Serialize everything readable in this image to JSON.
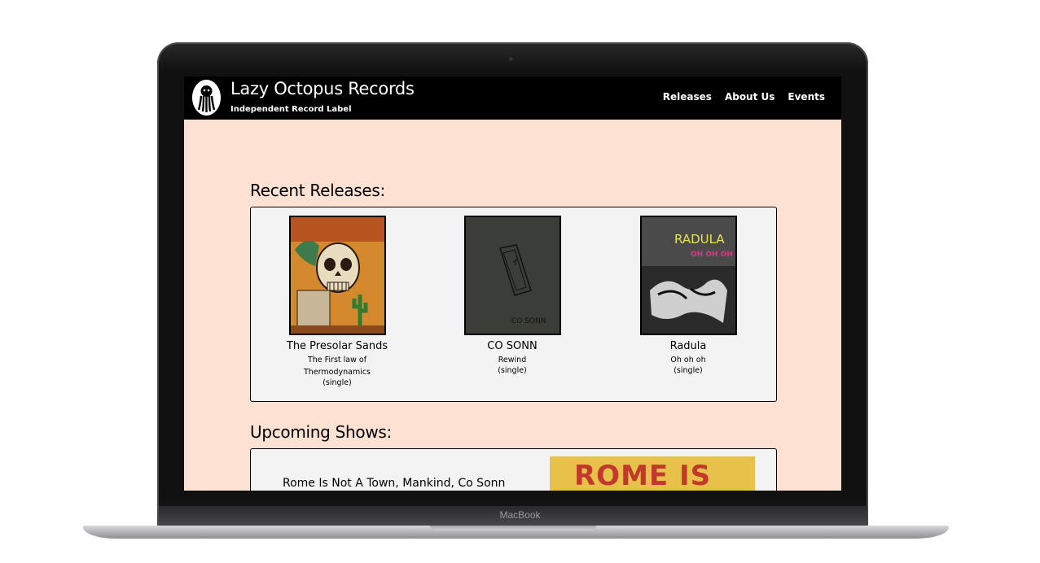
{
  "device": {
    "brand": "MacBook"
  },
  "site": {
    "title": "Lazy Octopus Records",
    "tagline": "Independent Record Label",
    "nav": [
      "Releases",
      "About Us",
      "Events"
    ]
  },
  "recent": {
    "heading": "Recent Releases:",
    "items": [
      {
        "artist": "The Presolar Sands",
        "title": "The First law of Thermodynamics",
        "format": "(single)",
        "cover_text": ""
      },
      {
        "artist": "CO SONN",
        "title": "Rewind",
        "format": "(single)",
        "cover_text": "CO SONN"
      },
      {
        "artist": "Radula",
        "title": "Oh oh oh",
        "format": "(single)",
        "cover_text": "RADULA",
        "cover_subtext": "OH OH OH"
      }
    ]
  },
  "shows": {
    "heading": "Upcoming Shows:",
    "items": [
      {
        "name": "Rome Is Not A Town, Mankind, Co Sonn",
        "poster_text": "ROME IS"
      }
    ]
  }
}
